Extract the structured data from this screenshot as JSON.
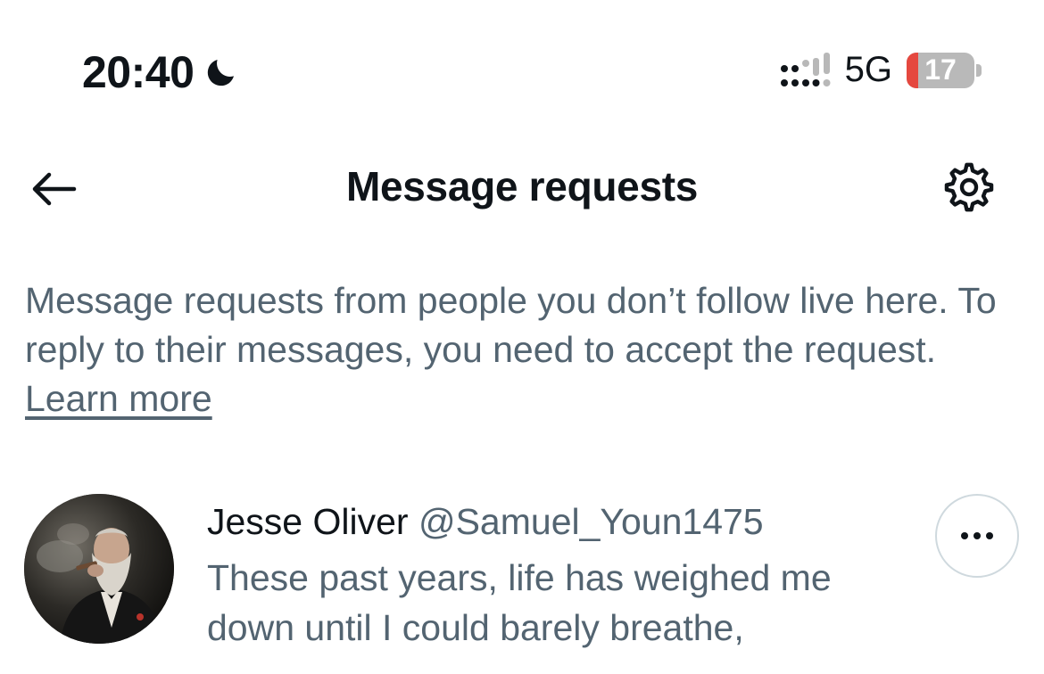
{
  "status_bar": {
    "time": "20:40",
    "focus_icon": "moon-icon",
    "signal_icon": "signal-icon",
    "network": "5G",
    "battery_level": "17",
    "battery_color": "#e5483f"
  },
  "header": {
    "back_icon": "arrow-left-icon",
    "title": "Message requests",
    "settings_icon": "gear-icon"
  },
  "description": {
    "text": "Message requests from people you don’t follow live here. To reply to their messages, you need to accept the request.",
    "link_label": "Learn more"
  },
  "requests": [
    {
      "name": "Jesse Oliver",
      "handle": "@Samuel_Youn1475",
      "preview": "These past years, life has weighed me down until I could barely breathe,",
      "more_icon": "more-horizontal-icon"
    }
  ],
  "colors": {
    "text_primary": "#0f1419",
    "text_secondary": "#536471",
    "border": "#cfd9de"
  }
}
